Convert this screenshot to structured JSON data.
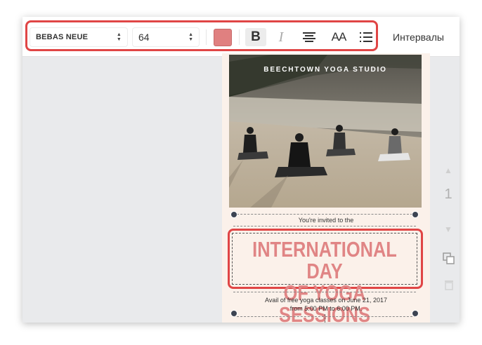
{
  "toolbar": {
    "font_family": "BEBAS NEUE",
    "font_size": "64",
    "text_color": "#e08080",
    "bold_label": "B",
    "italic_label": "I",
    "case_label": "AA",
    "spacing_label": "Интервалы"
  },
  "design": {
    "photo_title": "BEECHTOWN YOGA STUDIO",
    "invite_text": "You're invited to the",
    "heading_line1": "INTERNATIONAL DAY",
    "heading_line2": "OF YOGA SESSIONS",
    "details_line1": "Avail of free yoga classes on June 21, 2017",
    "details_line2": "from 5:00 PM to 6:00 PM.",
    "heading_color": "#e08585"
  },
  "sidebar": {
    "page_number": "1"
  },
  "colors": {
    "highlight": "#e04545",
    "canvas_bg": "#fbf1ea",
    "workspace_bg": "#e9eaec"
  }
}
